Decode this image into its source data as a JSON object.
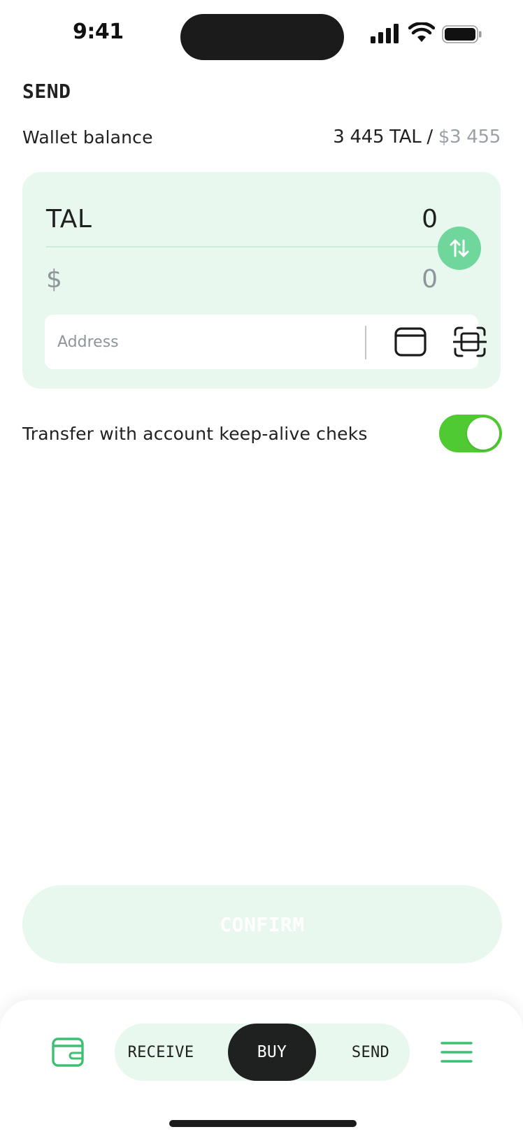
{
  "status_bar": {
    "time": "9:41"
  },
  "header": {
    "title": "SEND"
  },
  "balance": {
    "label": "Wallet balance",
    "tal_value": "3 445 TAL",
    "separator": " / ",
    "usd_value": "$3 455"
  },
  "card": {
    "primary_currency": "TAL",
    "primary_amount": "0",
    "secondary_currency": "$",
    "secondary_amount": "0",
    "address_placeholder": "Address",
    "address_value": "",
    "swap_icon": "swap-vertical-icon",
    "wallet_icon": "wallet-select-icon",
    "scan_icon": "qr-scan-icon"
  },
  "options": {
    "keep_alive_label": "Transfer with account keep-alive cheks",
    "keep_alive_enabled": "true"
  },
  "confirm": {
    "label": "CONFIRM"
  },
  "bottom_nav": {
    "receive_label": "RECEIVE",
    "buy_label": "BUY",
    "send_label": "SEND",
    "active": "BUY"
  },
  "colors": {
    "accent_green": "#6fd79c",
    "card_bg": "#e8f8ee",
    "toggle_on": "#4fca32",
    "nav_active_bg": "#1f2020",
    "muted_text": "#8e959b"
  }
}
